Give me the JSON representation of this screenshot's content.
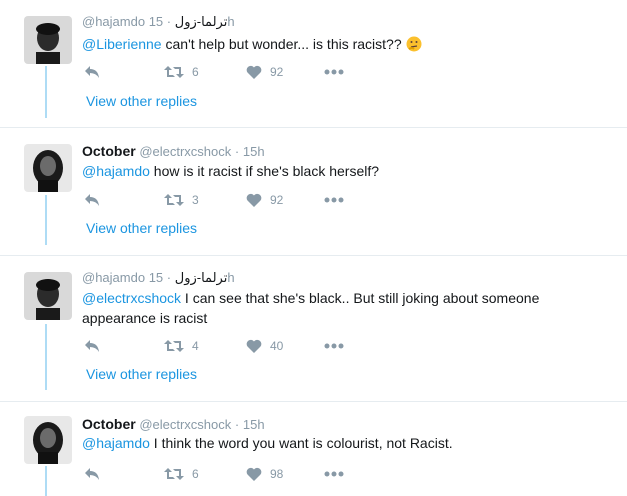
{
  "thread": {
    "view_replies_label": "View other replies",
    "tweets": [
      {
        "display_name": "@hajamdo",
        "display_name_ar": "ترلما-زول",
        "handle": "",
        "time": "15h",
        "mention": "@Liberienne",
        "text": " can't help but wonder... is this racist?? ",
        "emoji": "thinking-face-emoji",
        "retweets": "6",
        "likes": "92"
      },
      {
        "display_name": "October",
        "handle": "@electrxcshock",
        "time": "15h",
        "mention": "@hajamdo",
        "text": " how is it racist if she's black herself?",
        "retweets": "3",
        "likes": "92"
      },
      {
        "display_name": "@hajamdo",
        "display_name_ar": "ترلما-زول",
        "handle": "",
        "time": "15h",
        "mention": "@electrxcshock",
        "text": " I can see that she's black.. But still joking about someone appearance is racist",
        "retweets": "4",
        "likes": "40"
      },
      {
        "display_name": "October",
        "handle": "@electrxcshock",
        "time": "15h",
        "mention": "@hajamdo",
        "text": " I think the word you want is colourist, not Racist.",
        "retweets": "6",
        "likes": "98"
      }
    ]
  },
  "colors": {
    "link": "#1b95e0",
    "muted": "#8899a6",
    "thread_line": "#aedcf5",
    "divider": "#e6ecf0"
  },
  "icons": [
    "reply-icon",
    "retweet-icon",
    "heart-icon",
    "more-icon"
  ]
}
